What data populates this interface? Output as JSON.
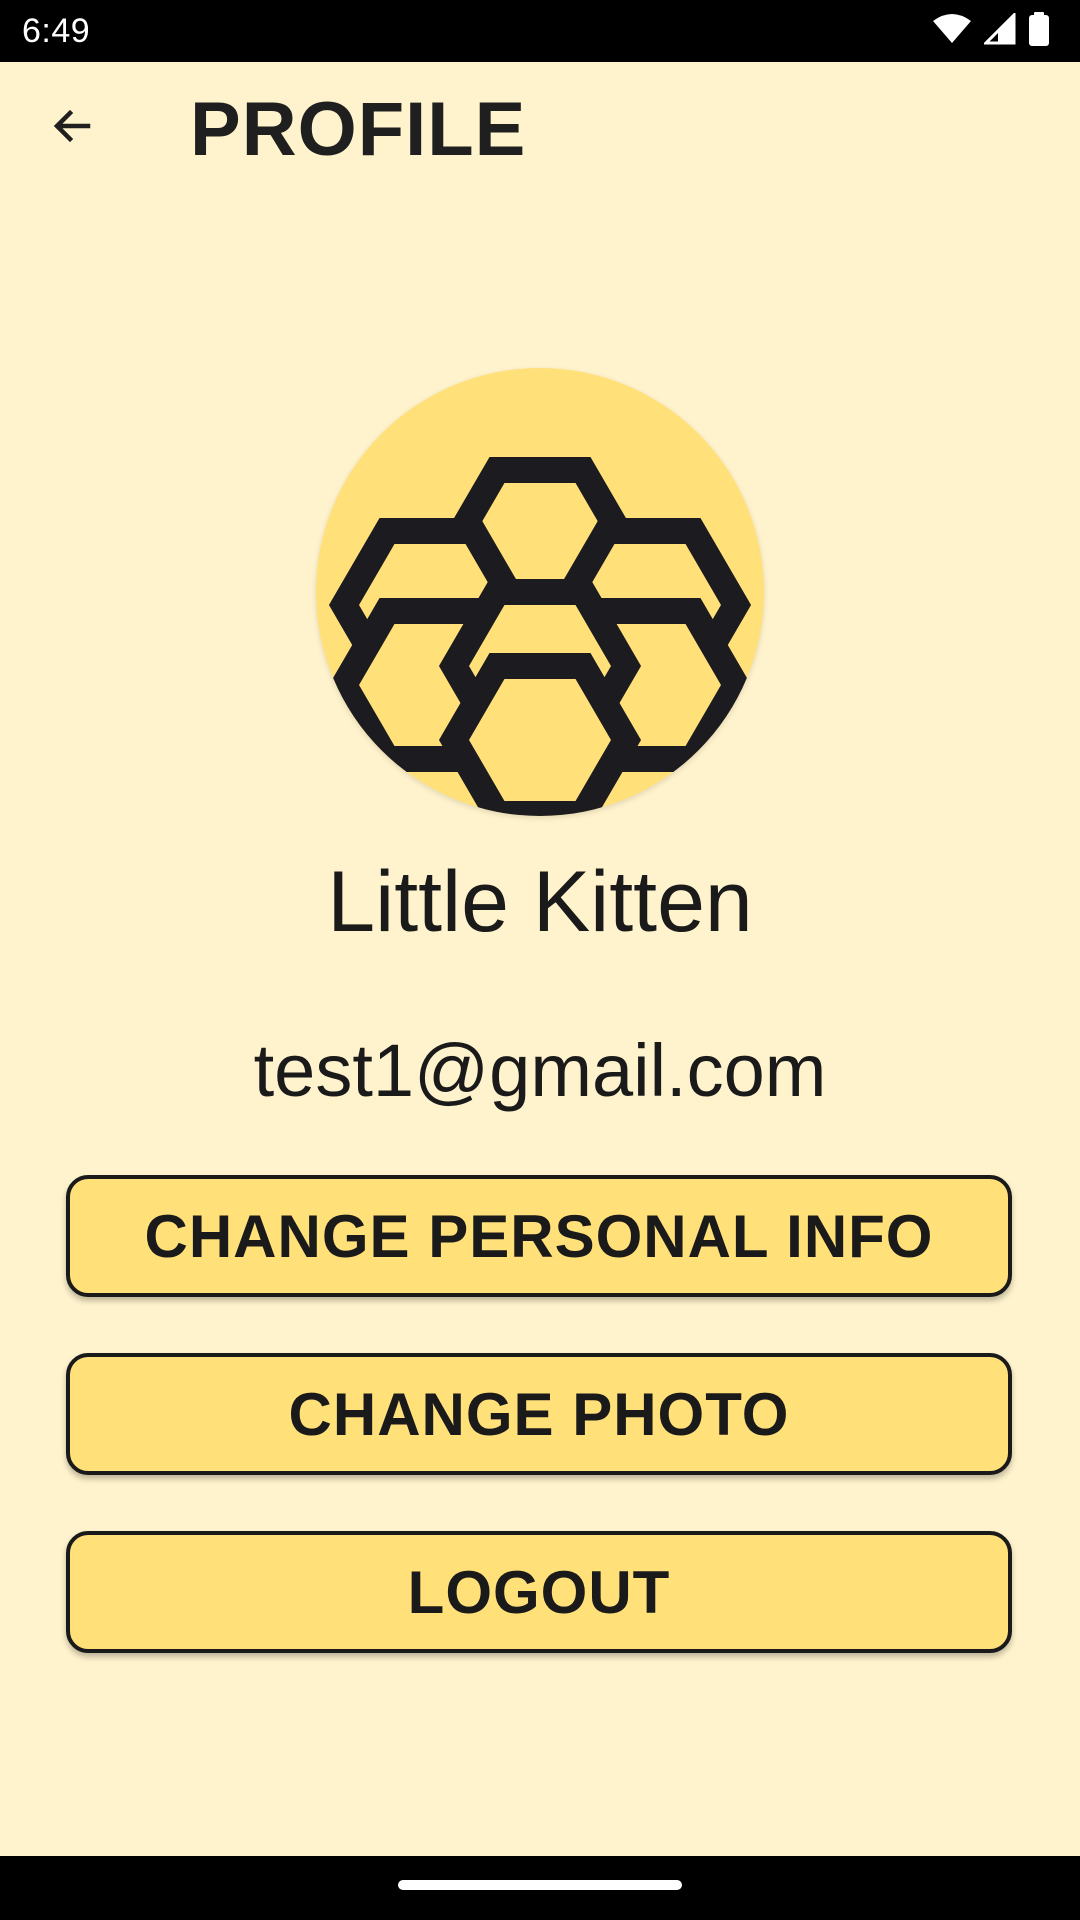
{
  "status_bar": {
    "time": "6:49",
    "icons": [
      "wifi-icon",
      "cell-signal-icon",
      "battery-icon"
    ]
  },
  "app_bar": {
    "back_icon": "arrow-left-icon",
    "title": "PROFILE"
  },
  "profile": {
    "avatar_icon": "honeycomb-icon",
    "name": "Little Kitten",
    "email": "test1@gmail.com"
  },
  "actions": {
    "change_info_label": "CHANGE PERSONAL INFO",
    "change_photo_label": "CHANGE PHOTO",
    "logout_label": "LOGOUT"
  },
  "colors": {
    "background": "#FFF3CD",
    "accent": "#FFE079",
    "text": "#1A1A1A",
    "system_bars": "#000000"
  }
}
